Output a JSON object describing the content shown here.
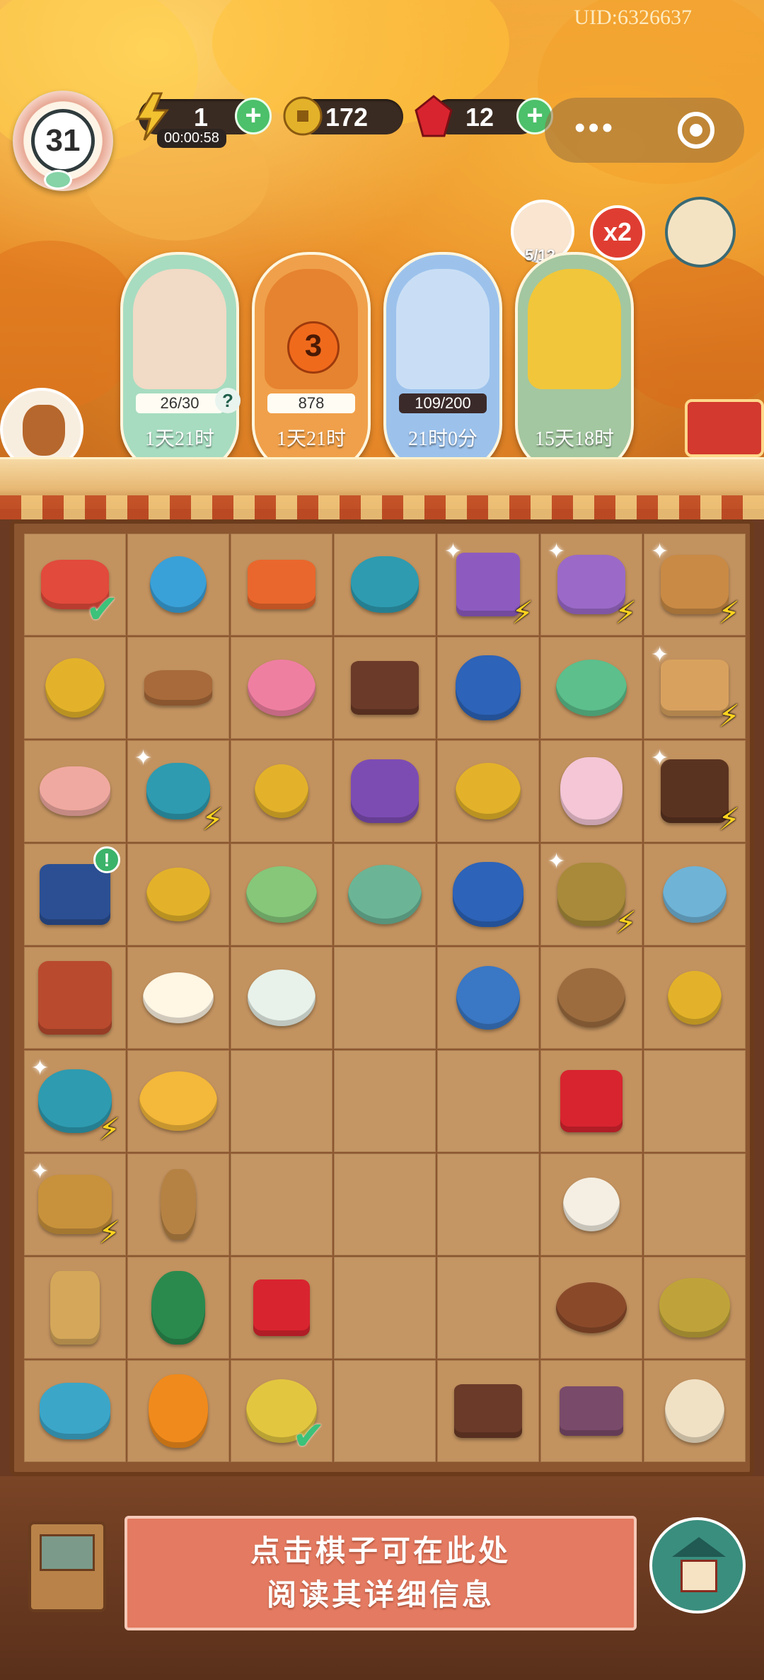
{
  "header": {
    "uid": "UID:6326637",
    "level": "31",
    "energy": {
      "value": "1",
      "timer": "00:00:58",
      "icon": "lightning-icon"
    },
    "coins": {
      "value": "172",
      "icon": "coin-icon"
    },
    "gems": {
      "value": "12",
      "icon": "ruby-icon"
    },
    "plus_label": "+",
    "cat_count": "5/12",
    "boost_label": "x2"
  },
  "events": [
    {
      "name": "tea-cat-event",
      "progress": "26/30",
      "time": "1天21时",
      "color": "#a7dcc0",
      "help": "?"
    },
    {
      "name": "pumpkin-event",
      "badge": "3",
      "progress": "878",
      "time": "1天21时",
      "color": "#f0a04a"
    },
    {
      "name": "paper-event",
      "progress": "109/200",
      "time": "21时0分",
      "color": "#9cc2ec"
    },
    {
      "name": "chrysanthemum-event",
      "time": "15天18时",
      "color": "#a3c7a0"
    }
  ],
  "board": {
    "rows": [
      [
        {
          "item": "watermelon-board",
          "check": true
        },
        {
          "item": "bead-bracelet"
        },
        {
          "item": "fruit-platter"
        },
        {
          "item": "teapot-set"
        },
        {
          "item": "scroll-box",
          "bolt": true
        },
        {
          "item": "silk-loom",
          "bolt": true
        },
        {
          "item": "fruit-basket",
          "bolt": true
        }
      ],
      [
        {
          "item": "gold-bracelet"
        },
        {
          "item": "silk-spindle"
        },
        {
          "item": "flower-dish"
        },
        {
          "item": "wooden-chest"
        },
        {
          "item": "blue-porcelain-bowl"
        },
        {
          "item": "red-bean-soup"
        },
        {
          "item": "scroll-crate",
          "bolt": true
        }
      ],
      [
        {
          "item": "pig-cake"
        },
        {
          "item": "teapot",
          "bolt": true
        },
        {
          "item": "gold-coin"
        },
        {
          "item": "purple-purse"
        },
        {
          "item": "coin-stack"
        },
        {
          "item": "rabbit-dessert"
        },
        {
          "item": "treasure-chest",
          "bolt": true
        }
      ],
      [
        {
          "item": "blue-gift-box",
          "alert": "!"
        },
        {
          "item": "coin-pair"
        },
        {
          "item": "green-bean-soup"
        },
        {
          "item": "tangyuan-bowl"
        },
        {
          "item": "porcelain-tea"
        },
        {
          "item": "rice-pot",
          "bolt": true
        },
        {
          "item": "tea-cup"
        }
      ],
      [
        {
          "item": "chicken-coop"
        },
        {
          "item": "fried-egg"
        },
        {
          "item": "berry-pudding"
        },
        {
          "item": ""
        },
        {
          "item": "blue-tea-cup"
        },
        {
          "item": "cotton-bowl"
        },
        {
          "item": "gold-coin"
        }
      ],
      [
        {
          "item": "teapot-and-cup",
          "bolt": true
        },
        {
          "item": "fried-rice-plate"
        },
        {
          "item": ""
        },
        {
          "item": ""
        },
        {
          "item": ""
        },
        {
          "item": "ruby-pair"
        },
        {
          "item": ""
        }
      ],
      [
        {
          "item": "harvest-basket",
          "bolt": true
        },
        {
          "item": "brush"
        },
        {
          "item": ""
        },
        {
          "item": ""
        },
        {
          "item": ""
        },
        {
          "item": "cotton-flower"
        },
        {
          "item": ""
        }
      ],
      [
        {
          "item": "ruler-brush"
        },
        {
          "item": "green-gourd"
        },
        {
          "item": "ruby"
        },
        {
          "item": ""
        },
        {
          "item": ""
        },
        {
          "item": "bird-nest"
        },
        {
          "item": "woven-basket"
        }
      ],
      [
        {
          "item": "blue-jar"
        },
        {
          "item": "energy-gourd"
        },
        {
          "item": "fried-rice-bowl",
          "check": true
        },
        {
          "item": ""
        },
        {
          "item": "small-chest"
        },
        {
          "item": "ink-stone"
        },
        {
          "item": "lantern"
        }
      ]
    ]
  },
  "bottom": {
    "info_line1": "点击棋子可在此处",
    "info_line2": "阅读其详细信息"
  },
  "colors": {
    "gold": "#f2c230",
    "coin": "#e3b22a",
    "ruby": "#d8242f",
    "green": "#4cc06a",
    "info_bg": "#e37a61"
  }
}
